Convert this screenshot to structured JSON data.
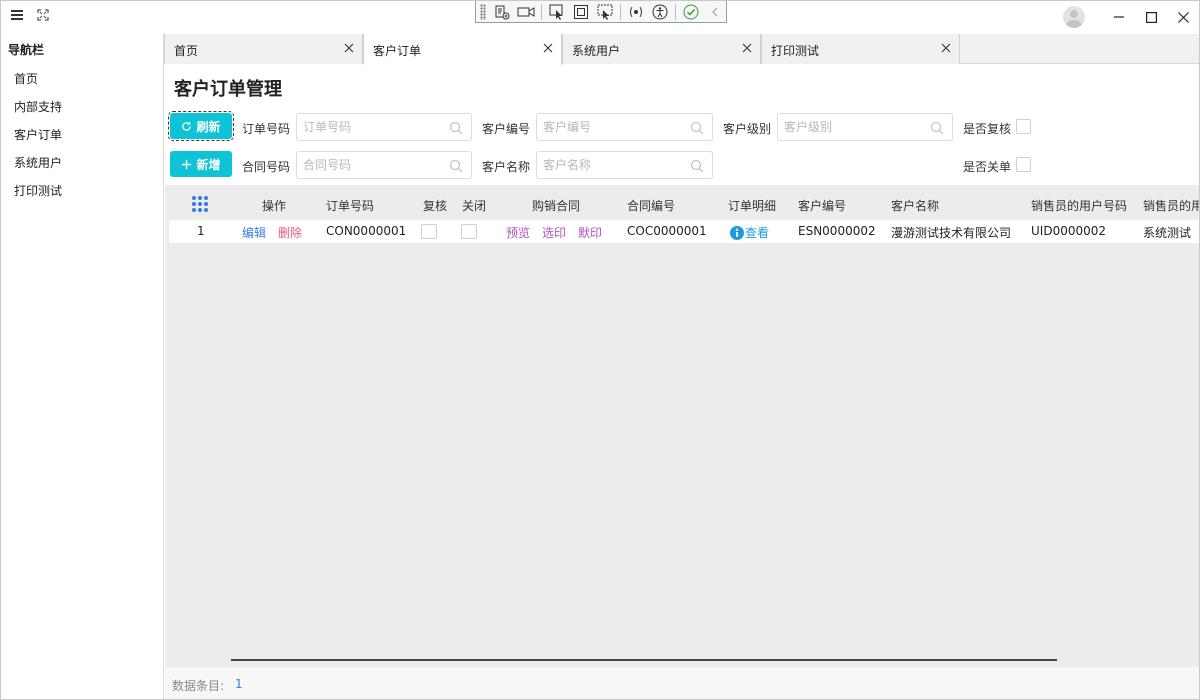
{
  "sidebar": {
    "title": "导航栏",
    "items": [
      {
        "label": "首页"
      },
      {
        "label": "内部支持"
      },
      {
        "label": "客户订单"
      },
      {
        "label": "系统用户"
      },
      {
        "label": "打印测试"
      }
    ]
  },
  "tabs": [
    {
      "label": "首页",
      "active": false
    },
    {
      "label": "客户订单",
      "active": true
    },
    {
      "label": "系统用户",
      "active": false
    },
    {
      "label": "打印测试",
      "active": false
    }
  ],
  "page": {
    "title": "客户订单管理"
  },
  "toolbar": {
    "refresh_label": "刷新",
    "add_label": "新增"
  },
  "filters": {
    "order_no": {
      "label": "订单号码",
      "placeholder": "订单号码"
    },
    "contract_no": {
      "label": "合同号码",
      "placeholder": "合同号码"
    },
    "customer_no": {
      "label": "客户编号",
      "placeholder": "客户编号"
    },
    "customer_name": {
      "label": "客户名称",
      "placeholder": "客户名称"
    },
    "customer_level": {
      "label": "客户级别",
      "placeholder": "客户级别"
    },
    "is_reviewed": {
      "label": "是否复核",
      "checked": false
    },
    "is_closed": {
      "label": "是否关单",
      "checked": false
    }
  },
  "table": {
    "columns": [
      "操作",
      "订单号码",
      "复核",
      "关闭",
      "购销合同",
      "合同编号",
      "订单明细",
      "客户编号",
      "客户名称",
      "销售员的用户号码",
      "销售员的用户名"
    ],
    "rows": [
      {
        "index": "1",
        "edit": "编辑",
        "delete": "删除",
        "order_no": "CON0000001",
        "reviewed": false,
        "closed": false,
        "preview": "预览",
        "print_select": "选印",
        "print_default": "默印",
        "contract_no": "COC0000001",
        "detail": "查看",
        "customer_no": "ESN0000002",
        "customer_name": "漫游测试技术有限公司",
        "sales_user_no": "UID0000002",
        "sales_user_name": "系统测试"
      }
    ]
  },
  "footer": {
    "count_label": "数据条目:",
    "count_value": "1"
  },
  "colors": {
    "accent": "#0fc3d6",
    "link": "#3a7be0",
    "danger": "#e65a7d",
    "print": "#b64fc4",
    "grid_bg": "#ececec"
  },
  "icons": [
    "menu-icon",
    "expand-icon",
    "avatar-icon",
    "minimize-icon",
    "maximize-icon",
    "close-icon",
    "search-icon",
    "refresh-icon",
    "plus-icon",
    "grid-dots-icon",
    "info-icon"
  ]
}
